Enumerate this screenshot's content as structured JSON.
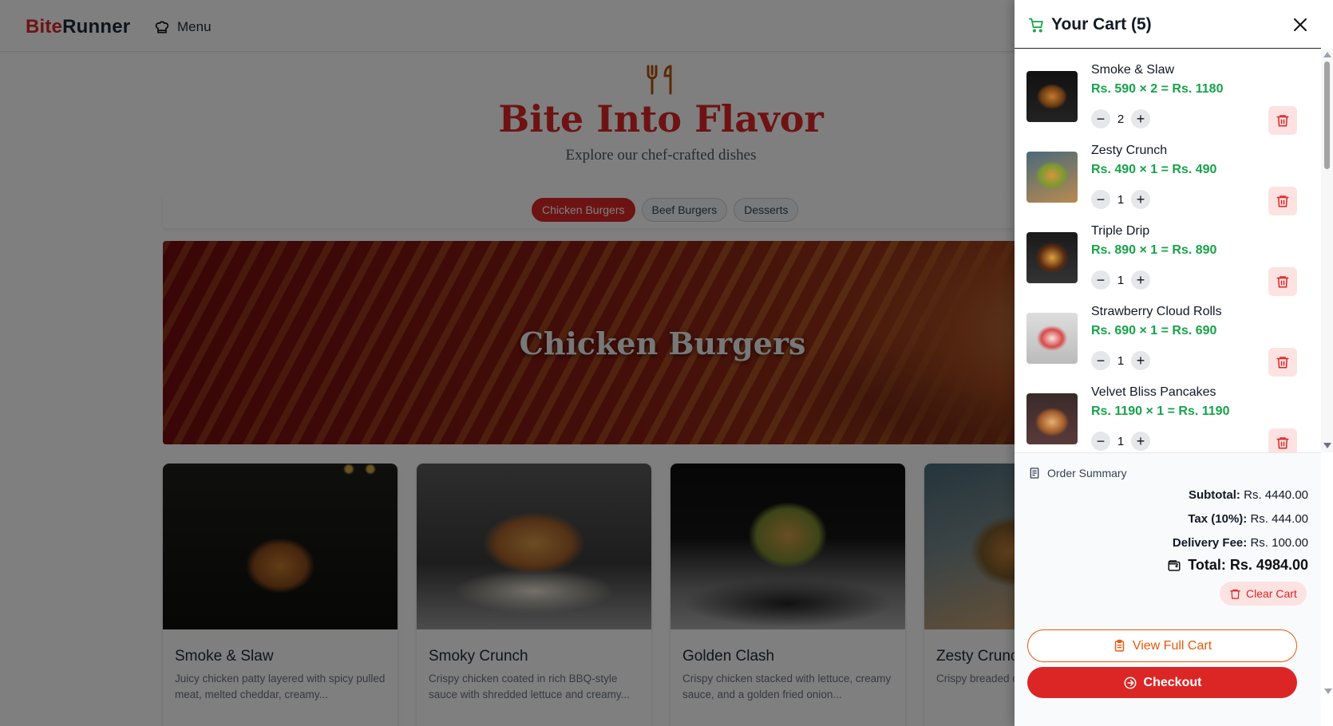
{
  "nav": {
    "brand_part1": "Bite",
    "brand_part2": "Runner",
    "menu_label": "Menu"
  },
  "hero": {
    "title": "Bite Into Flavor",
    "subtitle": "Explore our chef-crafted dishes"
  },
  "tabs": [
    {
      "label": "Chicken Burgers",
      "active": true
    },
    {
      "label": "Beef Burgers",
      "active": false
    },
    {
      "label": "Desserts",
      "active": false
    }
  ],
  "banner": {
    "title": "Chicken Burgers"
  },
  "cards": [
    {
      "name": "Smoke & Slaw",
      "desc": "Juicy chicken patty layered with spicy pulled meat, melted cheddar, creamy..."
    },
    {
      "name": "Smoky Crunch",
      "desc": "Crispy chicken coated in rich BBQ-style sauce with shredded lettuce and creamy..."
    },
    {
      "name": "Golden Clash",
      "desc": "Crispy chicken stacked with lettuce, creamy sauce, and a golden fried onion..."
    },
    {
      "name": "Zesty Crunch",
      "desc": "Crispy breaded creamy white sa..."
    }
  ],
  "cart": {
    "title": "Your Cart (5)",
    "items": [
      {
        "name": "Smoke & Slaw",
        "price_line": "Rs. 590 × 2 = Rs. 1180",
        "qty": "2",
        "minus": "−",
        "plus": "+"
      },
      {
        "name": "Zesty Crunch",
        "price_line": "Rs. 490 × 1 = Rs. 490",
        "qty": "1",
        "minus": "−",
        "plus": "+"
      },
      {
        "name": "Triple Drip",
        "price_line": "Rs. 890 × 1 = Rs. 890",
        "qty": "1",
        "minus": "−",
        "plus": "+"
      },
      {
        "name": "Strawberry Cloud Rolls",
        "price_line": "Rs. 690 × 1 = Rs. 690",
        "qty": "1",
        "minus": "−",
        "plus": "+"
      },
      {
        "name": "Velvet Bliss Pancakes",
        "price_line": "Rs. 1190 × 1 = Rs. 1190",
        "qty": "1",
        "minus": "−",
        "plus": "+"
      }
    ],
    "summary": {
      "heading": "Order Summary",
      "subtotal_label": "Subtotal:",
      "subtotal_value": "Rs. 4440.00",
      "tax_label": "Tax (10%):",
      "tax_value": "Rs. 444.00",
      "delivery_label": "Delivery Fee:",
      "delivery_value": "Rs. 100.00",
      "total_text": "Total: Rs. 4984.00",
      "clear_label": "Clear Cart",
      "view_label": "View Full Cart",
      "checkout_label": "Checkout"
    }
  },
  "colors": {
    "brand_red": "#dc2626",
    "price_green": "#16a34a",
    "view_orange": "#ea580c"
  }
}
